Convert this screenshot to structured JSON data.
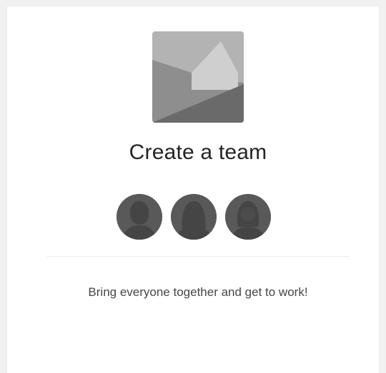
{
  "card": {
    "title": "Create a team",
    "description": "Bring everyone together and get to work!",
    "image_icon": "team-image-placeholder-icon",
    "avatars": [
      {
        "icon": "person-avatar-icon"
      },
      {
        "icon": "person-avatar-icon"
      },
      {
        "icon": "person-avatar-icon"
      }
    ]
  },
  "colors": {
    "page_background": "#f1f1f1",
    "card_background": "#ffffff",
    "title_text": "#252423",
    "description_text": "#484644",
    "avatar_fill": "#575757"
  }
}
